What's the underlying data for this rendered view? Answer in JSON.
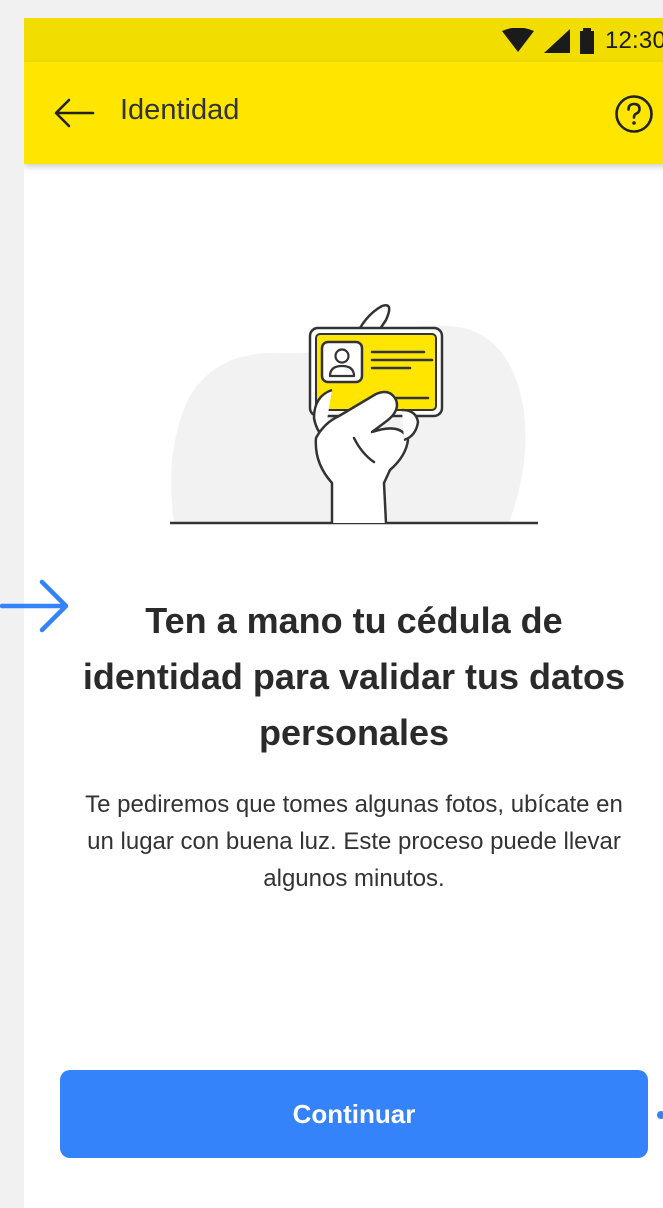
{
  "status_bar": {
    "time": "12:30",
    "icons": [
      "wifi-icon",
      "cellular-signal-icon",
      "battery-icon"
    ]
  },
  "app_bar": {
    "title": "Identidad",
    "back_icon": "arrow-left-icon",
    "help_icon": "question-circle-icon",
    "background_color": "#ffe600"
  },
  "illustration": {
    "subject": "hand-holding-id-card-icon",
    "accent_color": "#ffe600"
  },
  "content": {
    "title": "Ten a mano tu cédula de identidad para validar tus datos personales",
    "description": "Te pediremos que tomes algunas fotos, ubícate en un lugar con buena luz. Este proceso puede llevar algunos minutos."
  },
  "actions": {
    "continue_label": "Continuar",
    "continue_color": "#3483fa"
  },
  "annotations": {
    "pointer_icon": "arrow-right-icon",
    "color": "#3483fa"
  }
}
